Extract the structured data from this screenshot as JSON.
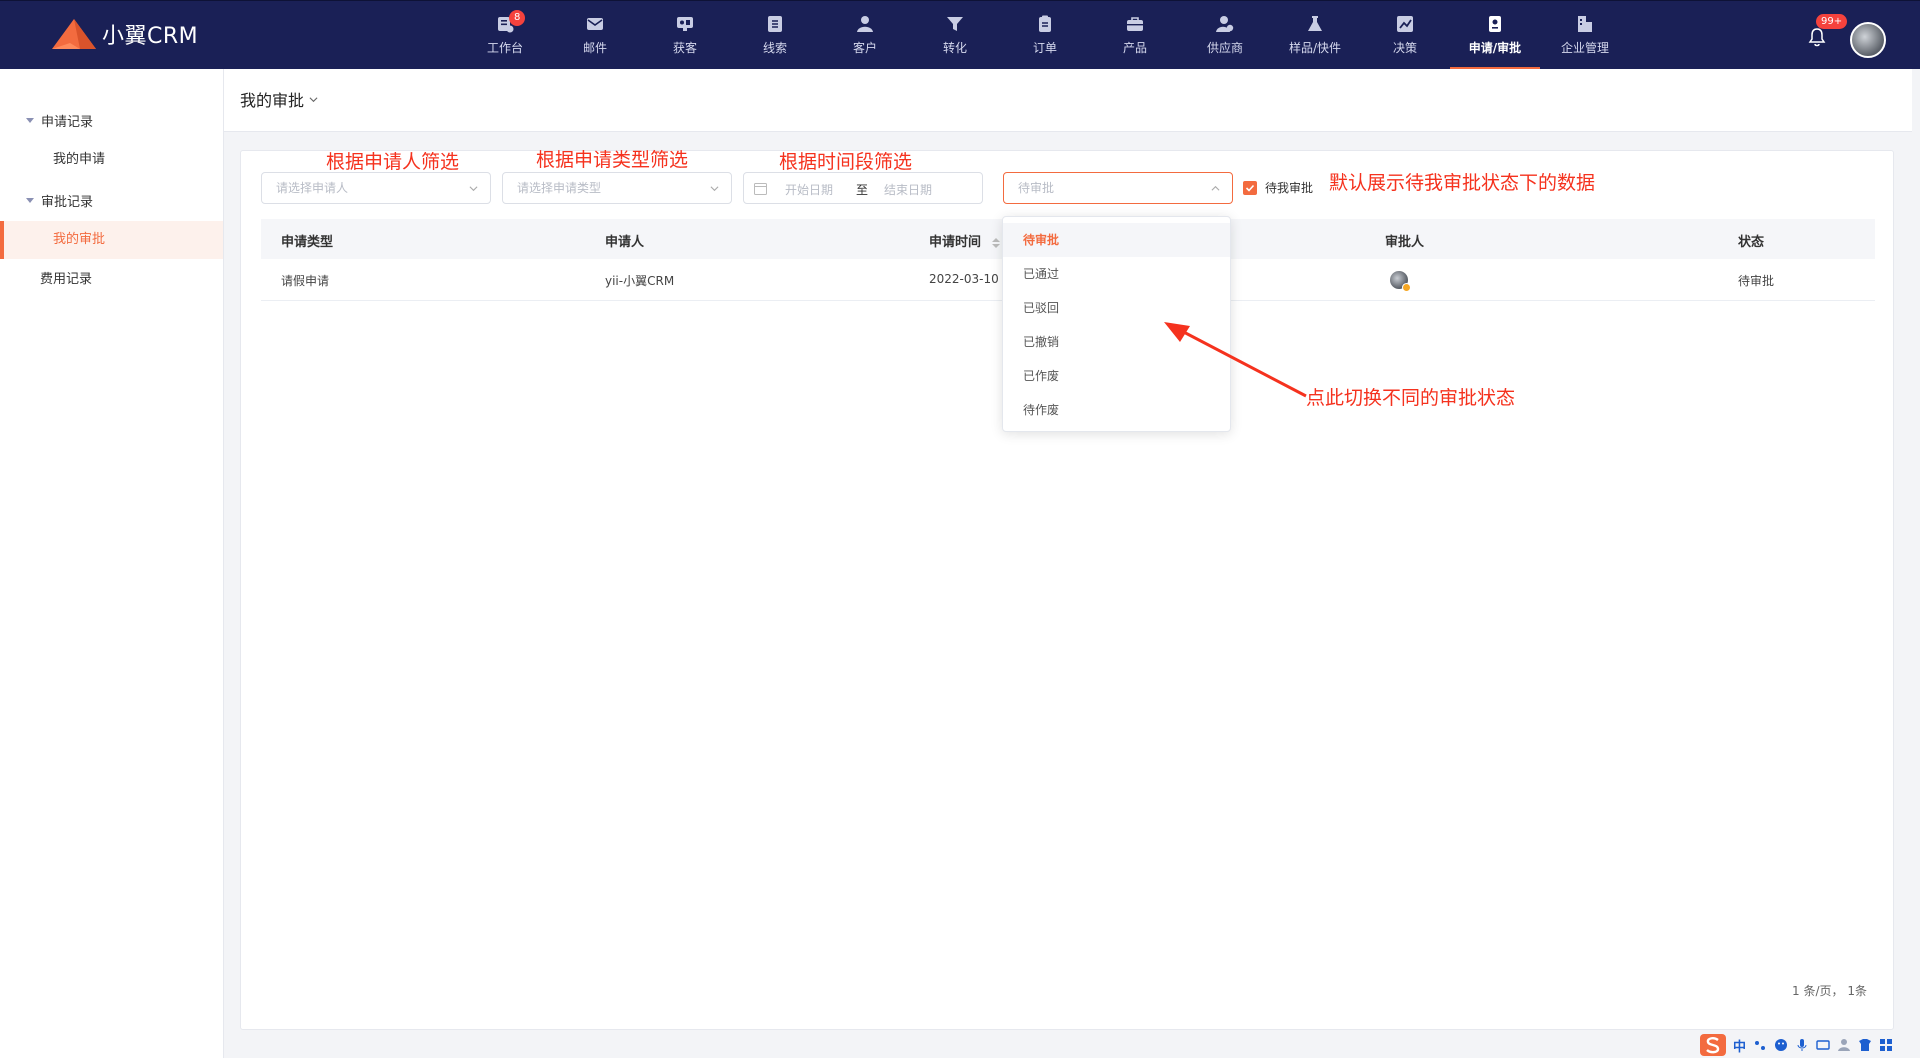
{
  "app": {
    "logo_text": "小翼CRM"
  },
  "nav": {
    "items": [
      {
        "label": "工作台",
        "icon": "workbench-icon",
        "badge": "8"
      },
      {
        "label": "邮件",
        "icon": "mail-icon"
      },
      {
        "label": "获客",
        "icon": "acquire-icon"
      },
      {
        "label": "线索",
        "icon": "leads-icon"
      },
      {
        "label": "客户",
        "icon": "customer-icon"
      },
      {
        "label": "转化",
        "icon": "funnel-icon"
      },
      {
        "label": "订单",
        "icon": "order-icon"
      },
      {
        "label": "产品",
        "icon": "product-icon"
      },
      {
        "label": "供应商",
        "icon": "supplier-icon"
      },
      {
        "label": "样品/快件",
        "icon": "flask-icon"
      },
      {
        "label": "决策",
        "icon": "chart-icon"
      },
      {
        "label": "申请/审批",
        "icon": "approval-icon",
        "active": true
      },
      {
        "label": "企业管理",
        "icon": "building-icon"
      }
    ],
    "notification_badge": "99+"
  },
  "sidebar": {
    "group1": "申请记录",
    "item_my_apply": "我的申请",
    "group2": "审批记录",
    "item_my_approval": "我的审批",
    "item_expense": "费用记录"
  },
  "page": {
    "title": "我的审批"
  },
  "filters": {
    "applicant_placeholder": "请选择申请人",
    "type_placeholder": "请选择申请类型",
    "date_start": "开始日期",
    "date_sep": "至",
    "date_end": "结束日期",
    "status_value": "待审批",
    "pending_me_label": "待我审批"
  },
  "annotations": {
    "a1": "根据申请人筛选",
    "a2": "根据申请类型筛选",
    "a3": "根据时间段筛选",
    "a4": "默认展示待我审批状态下的数据",
    "a5": "点此切换不同的审批状态"
  },
  "table": {
    "headers": {
      "type": "申请类型",
      "applicant": "申请人",
      "time": "申请时间",
      "approver": "审批人",
      "status": "状态"
    },
    "rows": [
      {
        "type": "请假申请",
        "applicant": "yii-小翼CRM",
        "time": "2022-03-10 2",
        "status": "待审批"
      }
    ]
  },
  "dropdown": {
    "options": [
      "待审批",
      "已通过",
      "已驳回",
      "已撤销",
      "已作废",
      "待作废"
    ],
    "selected": "待审批"
  },
  "pagination": {
    "text": "1 条/页，  1条"
  },
  "ime": {
    "mode": "中"
  },
  "colors": {
    "nav_bg": "#1a2056",
    "accent": "#f36b3f",
    "annotation": "#f5321e"
  }
}
